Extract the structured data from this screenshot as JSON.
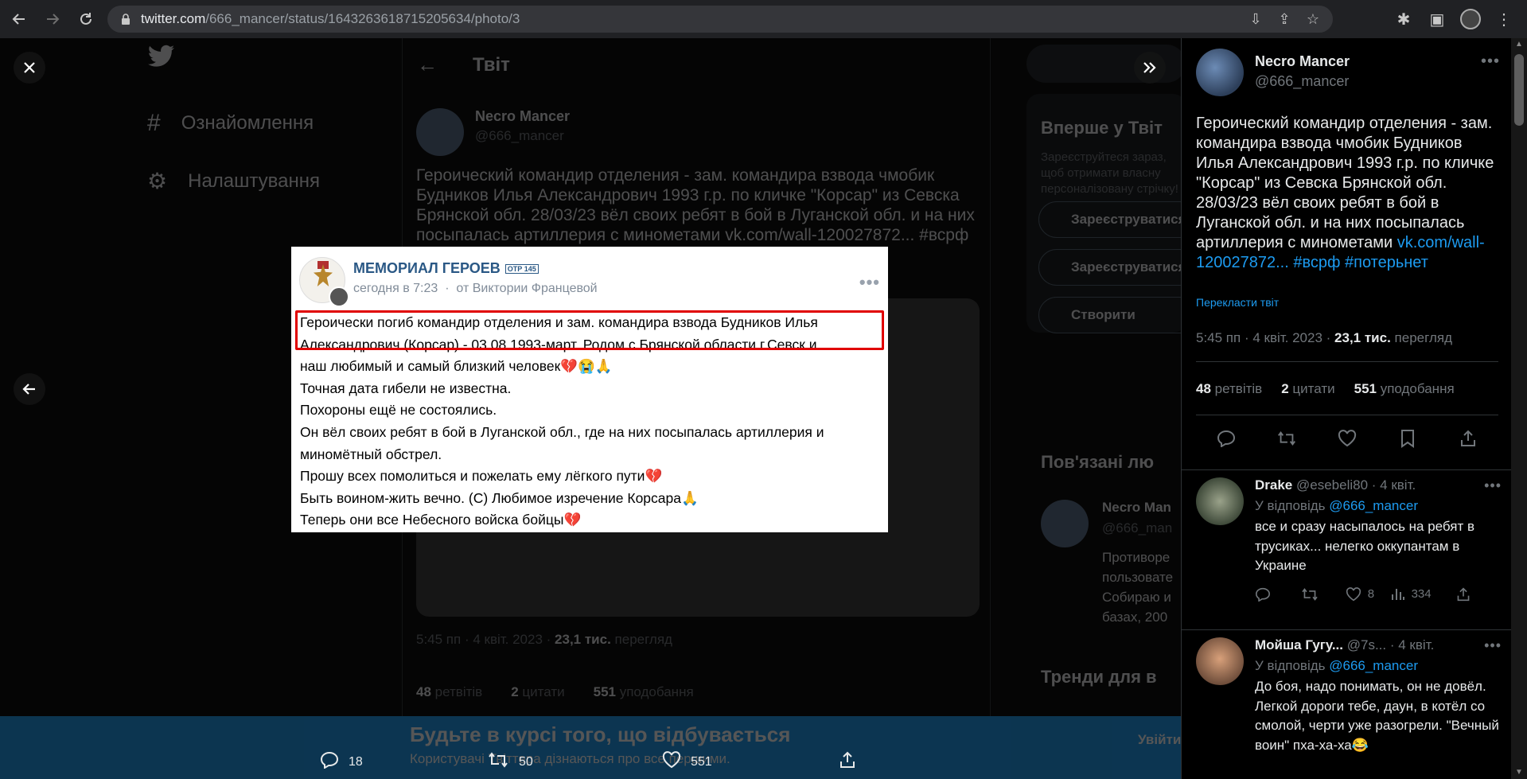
{
  "browser": {
    "url_host": "twitter.com",
    "url_path": "/666_mancer/status/1643263618715205634/photo/3"
  },
  "background": {
    "nav": [
      "Ознайомлення",
      "Налаштування"
    ],
    "header_title": "Твіт",
    "author_name": "Necro Mancer",
    "author_handle": "@666_mancer",
    "text_lines": [
      "Героический командир отделения - зам. командира взвода чмобик",
      "Будников Илья Александрович 1993 г.р. по кличке \"Корсар\" из Севска",
      "Брянской обл. 28/03/23 вёл своих ребят в бой в Луганской обл. и на них",
      "посыпалась артиллерия с минометами vk.com/wall-120027872... #всрф"
    ],
    "meta": "5:45 пп · 4 квіт. 2023",
    "views_num": "23,1 тис.",
    "views_word": "перегляд",
    "stats": {
      "retweets_num": "48",
      "retweets_word": "ретвітів",
      "quotes_num": "2",
      "quotes_word": "цитати",
      "likes_num": "551",
      "likes_word": "уподобання"
    },
    "right_heading_1": "Вперше у Твіт",
    "right_text_1": "Зареєструйтеся зараз, щоб отримати власну персоналізовану стрічку!",
    "btn_google": "Зареєструватися",
    "btn_apple": "Зареєструватися",
    "btn_create": "Створити",
    "right_heading_2": "Пов'язані лю",
    "related_name": "Necro Man",
    "related_handle": "@666_man",
    "related_text": [
      "Противоре",
      "пользовате",
      "Собираю и",
      "базах, 200"
    ],
    "right_heading_3": "Тренди для в",
    "banner_title": "Будьте в курсі того, що відбувається",
    "banner_text": "Користувачі Твіттера дізнаються про все першими.",
    "banner_btn": "Увійти"
  },
  "photo_actions": {
    "replies": "18",
    "retweets": "50",
    "likes": "551"
  },
  "vk_post": {
    "group_name": "МЕМОРИАЛ ГЕРОЕВ",
    "group_tag": "ОТР 145",
    "time": "сегодня в 7:23",
    "separator": "·",
    "author": "от Виктории Францевой",
    "lines": [
      "Героически погиб командир отделения и зам. командира взвода Будников Илья",
      "Александрович (Корсар) - 03.08.1993-март. Родом с Брянской области г.Севск и",
      "наш любимый и самый близкий человек💔😭🙏",
      "Точная дата гибели не известна.",
      "Похороны ещё не состоялись.",
      "Он вёл своих ребят в бой в Луганской обл., где на них посыпалась артиллерия и",
      "миномётный обстрел.",
      "Прошу всех помолиться и пожелать ему лёгкого пути💔",
      "Быть воином-жить вечно. (С) Любимое изречение Корсара🙏",
      "Теперь они все Небесного войска бойцы💔"
    ]
  },
  "panel": {
    "author_name": "Necro Mancer",
    "author_handle": "@666_mancer",
    "text_plain": "Героический командир отделения - зам. командира взвода чмобик Будников Илья Александрович 1993 г.р. по кличке \"Корсар\" из Севска Брянской обл. 28/03/23 вёл своих ребят в бой в Луганской обл. и на них посыпалась артиллерия с минометами",
    "text_link": "vk.com/wall-120027872...",
    "hashtag_1": "#всрф",
    "hashtag_2": "#потерьнет",
    "translate": "Перекласти твіт",
    "time": "5:45 пп · 4 квіт. 2023 ·",
    "views_num": "23,1 тис.",
    "views_word": "перегляд",
    "retweets_num": "48",
    "retweets_word": "ретвітів",
    "quotes_num": "2",
    "quotes_word": "цитати",
    "likes_num": "551",
    "likes_word": "уподобання",
    "replies": [
      {
        "name": "Drake",
        "handle": "@esebeli80",
        "date": "· 4 квіт.",
        "reply_to_label": "У відповідь",
        "reply_to": "@666_mancer",
        "text": "все и сразу насыпалось на ребят в трусиках... нелегко оккупантам в Украине",
        "likes": "8",
        "views": "334"
      },
      {
        "name": "Мойша Гугу...",
        "handle": "@7s...",
        "date": "· 4 квіт.",
        "reply_to_label": "У відповідь",
        "reply_to": "@666_mancer",
        "text": "До боя, надо понимать, он не довёл.  Легкой дороги тебе, даун, в котёл со смолой, черти уже разогрели. \"Вечный воин\" пха-ха-ха😂"
      }
    ]
  },
  "colors": {
    "twitter_blue": "#1d9bf0",
    "vk_blue": "#2a5885",
    "highlight_red": "#e00000"
  }
}
